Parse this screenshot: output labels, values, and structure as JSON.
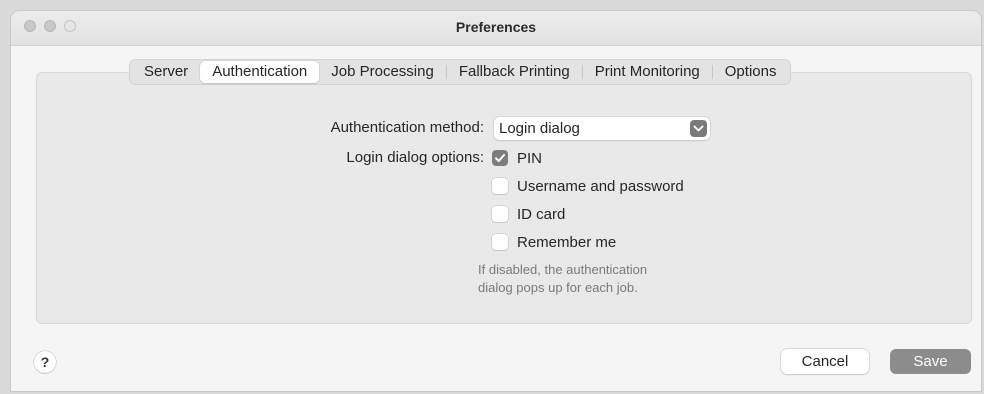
{
  "window": {
    "title": "Preferences"
  },
  "tabs": [
    {
      "label": "Server"
    },
    {
      "label": "Authentication"
    },
    {
      "label": "Job Processing"
    },
    {
      "label": "Fallback Printing"
    },
    {
      "label": "Print Monitoring"
    },
    {
      "label": "Options"
    }
  ],
  "active_tab": "Authentication",
  "auth": {
    "method_label": "Authentication method:",
    "method_value": "Login dialog",
    "options_label": "Login dialog options:",
    "options": [
      {
        "label": "PIN",
        "checked": true
      },
      {
        "label": "Username and password",
        "checked": false
      },
      {
        "label": "ID card",
        "checked": false
      },
      {
        "label": "Remember me",
        "checked": false
      }
    ],
    "hint_line1": "If disabled, the authentication",
    "hint_line2": "dialog pops up for each job."
  },
  "footer": {
    "help_label": "?",
    "cancel_label": "Cancel",
    "save_label": "Save"
  },
  "icons": {
    "dropdown": "chevron-down-icon",
    "check": "checkmark-icon"
  }
}
